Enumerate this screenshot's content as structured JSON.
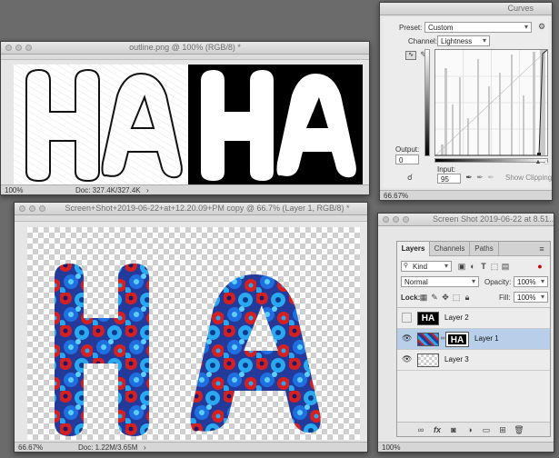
{
  "outline_window": {
    "title": "outline.png @ 100% (RGB/8) *",
    "zoom": "100%",
    "doc": "Doc: 327.4K/327.4K",
    "letters": "HA"
  },
  "curves_window": {
    "title": "Curves",
    "preset_label": "Preset:",
    "preset_value": "Custom",
    "channel_label": "Channel:",
    "channel_value": "Lightness",
    "output_label": "Output:",
    "output_value": "0",
    "input_label": "Input:",
    "input_value": "95",
    "show_clipping": "Show Clipping",
    "zoom": "66.67%"
  },
  "main_window": {
    "title": "Screen+Shot+2019-06-22+at+12.20.09+PM copy @ 66.7% (Layer 1, RGB/8) *",
    "zoom": "66.67%",
    "doc": "Doc: 1.22M/3.65M",
    "letters": "HA"
  },
  "layers_window": {
    "title": "Screen Shot 2019-06-22 at 8.51...",
    "zoom": "100%",
    "tabs": [
      "Layers",
      "Channels",
      "Paths"
    ],
    "kind_label": "Kind",
    "blend_mode": "Normal",
    "opacity_label": "Opacity:",
    "opacity_value": "100%",
    "lock_label": "Lock:",
    "fill_label": "Fill:",
    "fill_value": "100%",
    "thumb_text": "HA",
    "layers": [
      {
        "name": "Layer 2",
        "visible": false,
        "selected": false
      },
      {
        "name": "Layer 1",
        "visible": true,
        "selected": true
      },
      {
        "name": "Layer 3",
        "visible": true,
        "selected": false
      }
    ],
    "footer_icons": [
      "link-icon",
      "fx-icon",
      "mask-icon",
      "adjustment-icon",
      "group-icon",
      "new-layer-icon",
      "trash-icon"
    ]
  },
  "colors": {
    "selection": "#b8cfe9",
    "flower_red": "#d42020",
    "flower_blue": "#1f6fe0",
    "flower_cyan": "#2aa8f0",
    "flower_navy": "#243a9a"
  }
}
